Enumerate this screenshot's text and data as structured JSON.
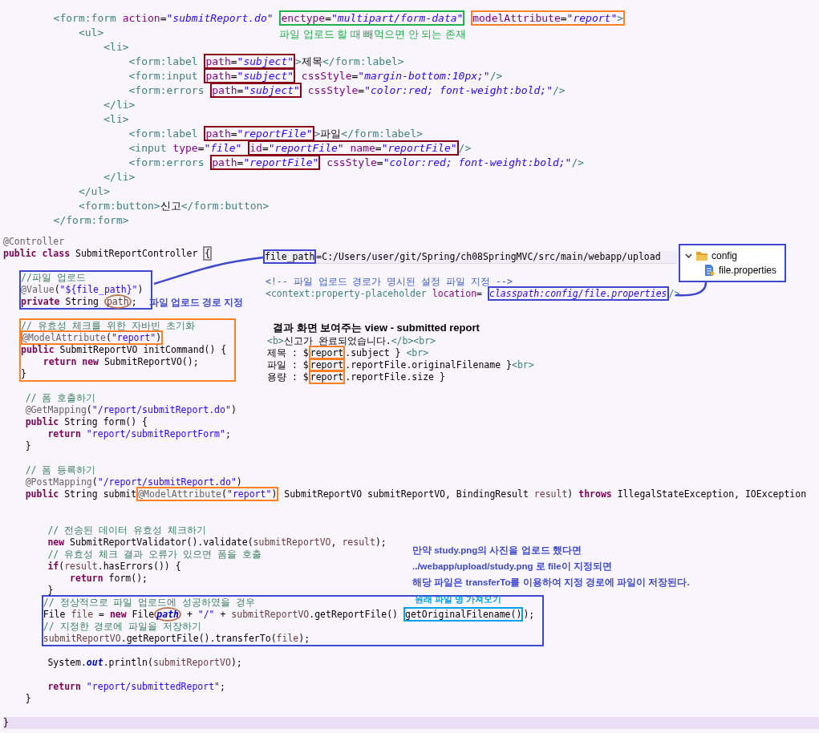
{
  "xml_form": {
    "lines": [
      {
        "kind": "line",
        "parts": [
          {
            "kind": "tag",
            "t": "        <form:form"
          },
          {
            "kind": "attr",
            "t": " action"
          },
          {
            "kind": "plain",
            "t": "="
          },
          {
            "kind": "val",
            "t": "\"submitReport.do\" "
          },
          {
            "kind": "box",
            "color": "#22b14c",
            "note": {
              "kind": "below",
              "text": "파일 업로드 할 때 빼먹으면 안 되는 존재",
              "color": "#22b14c"
            },
            "parts": [
              {
                "kind": "attr",
                "t": "enctype"
              },
              {
                "kind": "plain",
                "t": "="
              },
              {
                "kind": "val",
                "t": "\"multipart/form-data\""
              }
            ]
          },
          {
            "kind": "box",
            "color": "#ff7f27",
            "parts": [
              {
                "kind": "attr",
                "t": "modelAttribute"
              },
              {
                "kind": "plain",
                "t": "="
              },
              {
                "kind": "val",
                "t": "\"report\""
              },
              {
                "kind": "tag",
                "t": ">"
              }
            ]
          }
        ]
      },
      {
        "kind": "line",
        "parts": [
          {
            "kind": "tag",
            "t": "            <ul>"
          }
        ]
      },
      {
        "kind": "line",
        "parts": [
          {
            "kind": "tag",
            "t": "                <li>"
          }
        ]
      },
      {
        "kind": "line",
        "parts": [
          {
            "kind": "tag",
            "t": "                    <form:label "
          },
          {
            "kind": "box",
            "color": "#880015",
            "parts": [
              {
                "kind": "attr",
                "t": "path"
              },
              {
                "kind": "plain",
                "t": "="
              },
              {
                "kind": "val",
                "t": "\"subject\""
              }
            ]
          },
          {
            "kind": "tag",
            "t": ">"
          },
          {
            "kind": "plain",
            "t": "제목"
          },
          {
            "kind": "tag",
            "t": "</form:label>"
          }
        ]
      },
      {
        "kind": "line",
        "parts": [
          {
            "kind": "tag",
            "t": "                    <form:input "
          },
          {
            "kind": "box",
            "color": "#880015",
            "parts": [
              {
                "kind": "attr",
                "t": "path"
              },
              {
                "kind": "plain",
                "t": "="
              },
              {
                "kind": "val",
                "t": "\"subject\""
              }
            ]
          },
          {
            "kind": "attr",
            "t": " cssStyle"
          },
          {
            "kind": "plain",
            "t": "="
          },
          {
            "kind": "val",
            "t": "\"margin-bottom:10px;\""
          },
          {
            "kind": "tag",
            "t": "/>"
          }
        ]
      },
      {
        "kind": "line",
        "parts": [
          {
            "kind": "tag",
            "t": "                    <form:errors "
          },
          {
            "kind": "box",
            "color": "#880015",
            "parts": [
              {
                "kind": "attr",
                "t": "path"
              },
              {
                "kind": "plain",
                "t": "="
              },
              {
                "kind": "val",
                "t": "\"subject\""
              }
            ]
          },
          {
            "kind": "attr",
            "t": " cssStyle"
          },
          {
            "kind": "plain",
            "t": "="
          },
          {
            "kind": "val",
            "t": "\"color:red; font-weight:bold;\""
          },
          {
            "kind": "tag",
            "t": "/>"
          }
        ]
      },
      {
        "kind": "line",
        "parts": [
          {
            "kind": "tag",
            "t": "                </li>"
          }
        ]
      },
      {
        "kind": "line",
        "parts": [
          {
            "kind": "tag",
            "t": "                <li>"
          }
        ]
      },
      {
        "kind": "line",
        "parts": [
          {
            "kind": "tag",
            "t": "                    <form:label "
          },
          {
            "kind": "box",
            "color": "#880015",
            "parts": [
              {
                "kind": "attr",
                "t": "path"
              },
              {
                "kind": "plain",
                "t": "="
              },
              {
                "kind": "val",
                "t": "\"reportFile\""
              }
            ]
          },
          {
            "kind": "tag",
            "t": ">"
          },
          {
            "kind": "plain",
            "t": "파일"
          },
          {
            "kind": "tag",
            "t": "</form:label>"
          }
        ]
      },
      {
        "kind": "line",
        "parts": [
          {
            "kind": "tag",
            "t": "                    <input "
          },
          {
            "kind": "attr",
            "t": "type"
          },
          {
            "kind": "plain",
            "t": "="
          },
          {
            "kind": "val",
            "t": "\"file\" "
          },
          {
            "kind": "box",
            "color": "#880015",
            "parts": [
              {
                "kind": "attr",
                "t": "id"
              },
              {
                "kind": "plain",
                "t": "="
              },
              {
                "kind": "val",
                "t": "\"reportFile\""
              },
              {
                "kind": "attr",
                "t": " name"
              },
              {
                "kind": "plain",
                "t": "="
              },
              {
                "kind": "val",
                "t": "\"reportFile\""
              }
            ]
          },
          {
            "kind": "tag",
            "t": "/>"
          }
        ]
      },
      {
        "kind": "line",
        "parts": [
          {
            "kind": "tag",
            "t": "                    <form:errors "
          },
          {
            "kind": "box",
            "color": "#880015",
            "parts": [
              {
                "kind": "attr",
                "t": "path"
              },
              {
                "kind": "plain",
                "t": "="
              },
              {
                "kind": "val",
                "t": "\"reportFile\""
              }
            ]
          },
          {
            "kind": "attr",
            "t": " cssStyle"
          },
          {
            "kind": "plain",
            "t": "="
          },
          {
            "kind": "val",
            "t": "\"color:red; font-weight:bold;\""
          },
          {
            "kind": "tag",
            "t": "/>"
          }
        ]
      },
      {
        "kind": "line",
        "parts": [
          {
            "kind": "tag",
            "t": "                </li>"
          }
        ]
      },
      {
        "kind": "line",
        "parts": [
          {
            "kind": "tag",
            "t": "            </ul>"
          }
        ]
      },
      {
        "kind": "line",
        "parts": [
          {
            "kind": "tag",
            "t": "            <form:button>"
          },
          {
            "kind": "plain",
            "t": "신고"
          },
          {
            "kind": "tag",
            "t": "</form:button>"
          }
        ]
      },
      {
        "kind": "line",
        "parts": [
          {
            "kind": "tag",
            "t": "        </form:form>"
          }
        ]
      }
    ]
  },
  "controller_code": {
    "lines": [
      {
        "kind": "line",
        "parts": [
          {
            "kind": "ann",
            "t": "@Controller"
          }
        ]
      },
      {
        "kind": "line",
        "parts": [
          {
            "kind": "kw",
            "t": "public class"
          },
          {
            "kind": "plain",
            "t": " SubmitReportController "
          },
          {
            "kind": "box",
            "color": "#8c8c8c",
            "parts": [
              {
                "kind": "plain",
                "t": "{"
              }
            ]
          }
        ]
      },
      {
        "kind": "blank"
      },
      {
        "kind": "member_group",
        "color": "#3f48cc",
        "lines": [
          {
            "kind": "line",
            "parts": [
              {
                "kind": "cm",
                "t": "//파일 업로드"
              }
            ]
          },
          {
            "kind": "line",
            "parts": [
              {
                "kind": "ann",
                "t": "@Value"
              },
              {
                "kind": "plain",
                "t": "("
              },
              {
                "kind": "str",
                "t": "\"${file_path}\""
              },
              {
                "kind": "plain",
                "t": ")"
              }
            ]
          },
          {
            "kind": "line",
            "parts": [
              {
                "kind": "kw",
                "t": "private"
              },
              {
                "kind": "plain",
                "t": " String "
              },
              {
                "kind": "circle",
                "color": "#b97a57",
                "note": {
                  "kind": "right",
                  "text": "파일 업로드 경로 지정",
                  "color": "#3f48cc"
                },
                "parts": [
                  {
                    "kind": "var",
                    "t": "path"
                  }
                ]
              },
              {
                "kind": "plain",
                "t": ";"
              }
            ]
          }
        ]
      },
      {
        "kind": "blank"
      },
      {
        "kind": "member_group",
        "color": "#ff7f27",
        "lines": [
          {
            "kind": "line",
            "parts": [
              {
                "kind": "cm",
                "t": "// 유효성 체크를 위한 자바빈 초기화"
              }
            ]
          },
          {
            "kind": "line",
            "parts": [
              {
                "kind": "box",
                "color": "#ff7f27",
                "parts": [
                  {
                    "kind": "ann",
                    "t": "@ModelAttribute"
                  },
                  {
                    "kind": "plain",
                    "t": "("
                  },
                  {
                    "kind": "str",
                    "t": "\"report\""
                  },
                  {
                    "kind": "plain",
                    "t": ")"
                  }
                ]
              }
            ]
          },
          {
            "kind": "line",
            "parts": [
              {
                "kind": "kw",
                "t": "public"
              },
              {
                "kind": "plain",
                "t": " SubmitReportVO initCommand() {"
              }
            ]
          },
          {
            "kind": "line",
            "parts": [
              {
                "kind": "kw",
                "t": "    return new"
              },
              {
                "kind": "plain",
                "t": " SubmitReportVO();"
              }
            ]
          },
          {
            "kind": "line",
            "parts": [
              {
                "kind": "plain",
                "t": "}"
              }
            ]
          }
        ]
      },
      {
        "kind": "blank"
      },
      {
        "kind": "line",
        "parts": [
          {
            "kind": "cm",
            "t": "    // 폼 호출하기"
          }
        ]
      },
      {
        "kind": "line",
        "parts": [
          {
            "kind": "ann",
            "t": "    @GetMapping"
          },
          {
            "kind": "plain",
            "t": "("
          },
          {
            "kind": "str",
            "t": "\"/report/submitReport.do\""
          },
          {
            "kind": "plain",
            "t": ")"
          }
        ]
      },
      {
        "kind": "line",
        "parts": [
          {
            "kind": "kw",
            "t": "    public"
          },
          {
            "kind": "plain",
            "t": " String form() {"
          }
        ]
      },
      {
        "kind": "line",
        "parts": [
          {
            "kind": "kw",
            "t": "        return"
          },
          {
            "kind": "str",
            "t": " \"report/submitReportForm\""
          },
          {
            "kind": "plain",
            "t": ";"
          }
        ]
      },
      {
        "kind": "line",
        "parts": [
          {
            "kind": "plain",
            "t": "    }"
          }
        ]
      },
      {
        "kind": "blank"
      },
      {
        "kind": "line",
        "parts": [
          {
            "kind": "cm",
            "t": "    // 폼 등록하기"
          }
        ]
      },
      {
        "kind": "line",
        "parts": [
          {
            "kind": "ann",
            "t": "    @PostMapping"
          },
          {
            "kind": "plain",
            "t": "("
          },
          {
            "kind": "str",
            "t": "\"/report/submitReport.do\""
          },
          {
            "kind": "plain",
            "t": ")"
          }
        ]
      },
      {
        "kind": "line",
        "parts": [
          {
            "kind": "kw",
            "t": "    public"
          },
          {
            "kind": "plain",
            "t": " String submit"
          },
          {
            "kind": "box",
            "color": "#ff7f27",
            "parts": [
              {
                "kind": "ann",
                "t": "@ModelAttribute"
              },
              {
                "kind": "plain",
                "t": "("
              },
              {
                "kind": "str",
                "t": "\"report\""
              },
              {
                "kind": "plain",
                "t": ")"
              }
            ]
          },
          {
            "kind": "plain",
            "t": " SubmitReportVO submitReportVO, BindingResult "
          },
          {
            "kind": "var",
            "t": "result"
          },
          {
            "kind": "plain",
            "t": ") "
          },
          {
            "kind": "kw",
            "t": "throws"
          },
          {
            "kind": "plain",
            "t": " IllegalStateException, IOException"
          }
        ]
      },
      {
        "kind": "blank"
      },
      {
        "kind": "blank"
      },
      {
        "kind": "line",
        "parts": [
          {
            "kind": "cm",
            "t": "        // 전송된 데이터 유효성 체크하기"
          }
        ]
      },
      {
        "kind": "line",
        "parts": [
          {
            "kind": "kw",
            "t": "        new"
          },
          {
            "kind": "plain",
            "t": " SubmitReportValidator().validate("
          },
          {
            "kind": "var",
            "t": "submitReportVO"
          },
          {
            "kind": "plain",
            "t": ", "
          },
          {
            "kind": "var",
            "t": "result"
          },
          {
            "kind": "plain",
            "t": ");"
          }
        ]
      },
      {
        "kind": "line",
        "parts": [
          {
            "kind": "cm",
            "t": "        // 유효성 체크 결과 오류가 있으면 폼을 호출"
          }
        ]
      },
      {
        "kind": "line",
        "parts": [
          {
            "kind": "kw",
            "t": "        if"
          },
          {
            "kind": "plain",
            "t": "("
          },
          {
            "kind": "var",
            "t": "result"
          },
          {
            "kind": "plain",
            "t": ".hasErrors()) {"
          }
        ]
      },
      {
        "kind": "line",
        "parts": [
          {
            "kind": "kw",
            "t": "            return"
          },
          {
            "kind": "plain",
            "t": " form();"
          }
        ]
      },
      {
        "kind": "line",
        "parts": [
          {
            "kind": "plain",
            "t": "        }"
          }
        ]
      },
      {
        "kind": "statement_group",
        "color": "#3f48cc",
        "lines": [
          {
            "kind": "line",
            "parts": [
              {
                "kind": "cm",
                "t": "// 정상적으로 파일 업로드에 성공하였을 경우"
              }
            ]
          },
          {
            "kind": "line",
            "parts": [
              {
                "kind": "plain",
                "t": "File "
              },
              {
                "kind": "var",
                "t": "file"
              },
              {
                "kind": "plain",
                "t": " = "
              },
              {
                "kind": "kw",
                "t": "new"
              },
              {
                "kind": "plain",
                "t": " File"
              },
              {
                "kind": "circle",
                "color": "#b97a57",
                "parts": [
                  {
                    "kind": "fld",
                    "t": "path"
                  }
                ]
              },
              {
                "kind": "plain",
                "t": " + "
              },
              {
                "kind": "str",
                "t": "\"/\""
              },
              {
                "kind": "plain",
                "t": " + "
              },
              {
                "kind": "var",
                "t": "submitReportVO"
              },
              {
                "kind": "plain",
                "t": ".getReportFile() "
              },
              {
                "kind": "box",
                "color": "#00a2e8",
                "note": {
                  "kind": "above",
                  "text": "원래 파일 명 가져오기",
                  "color": "#00a2e8"
                },
                "parts": [
                  {
                    "kind": "plain",
                    "t": "getOriginalFilename()"
                  }
                ]
              },
              {
                "kind": "plain",
                "t": ");"
              }
            ]
          },
          {
            "kind": "line",
            "parts": [
              {
                "kind": "cm",
                "t": "// 지정한 경로에 파일을 저장하기"
              }
            ]
          },
          {
            "kind": "line",
            "parts": [
              {
                "kind": "var",
                "t": "submitReportVO"
              },
              {
                "kind": "plain",
                "t": ".getReportFile().transferTo("
              },
              {
                "kind": "var",
                "t": "file"
              },
              {
                "kind": "plain",
                "t": ");"
              }
            ]
          }
        ]
      },
      {
        "kind": "blank"
      },
      {
        "kind": "line",
        "parts": [
          {
            "kind": "plain",
            "t": "        System."
          },
          {
            "kind": "fld",
            "t": "out"
          },
          {
            "kind": "plain",
            "t": ".println("
          },
          {
            "kind": "var",
            "t": "submitReportVO"
          },
          {
            "kind": "plain",
            "t": ");"
          }
        ]
      },
      {
        "kind": "blank"
      },
      {
        "kind": "line",
        "parts": [
          {
            "kind": "kw",
            "t": "        return"
          },
          {
            "kind": "str",
            "t": " \"report/submittedReport\""
          },
          {
            "kind": "plain",
            "t": ";"
          }
        ]
      },
      {
        "kind": "line",
        "parts": [
          {
            "kind": "plain",
            "t": "    }"
          }
        ]
      },
      {
        "kind": "blank"
      },
      {
        "kind": "current",
        "parts": [
          {
            "kind": "plain",
            "t": "}"
          }
        ]
      }
    ]
  },
  "properties_line": {
    "parts": [
      {
        "kind": "box",
        "color": "#3f48cc",
        "parts": [
          {
            "kind": "plain",
            "t": "file_path"
          }
        ]
      },
      {
        "kind": "plain",
        "t": "=C:/Users/user/git/Spring/ch08SpringMVC/src/main/webapp/upload"
      }
    ]
  },
  "project_tree": [
    {
      "label": "config",
      "kind": "folder",
      "expanded": true,
      "children": [
        {
          "label": "file.properties",
          "kind": "file"
        }
      ]
    }
  ],
  "config_xml": {
    "lines": [
      {
        "kind": "line",
        "parts": [
          {
            "kind": "xc",
            "t": "<!-- 파일 업로드 경로가 명시된 설정 파일 지정 -->"
          }
        ]
      },
      {
        "kind": "line",
        "parts": [
          {
            "kind": "tag",
            "t": "<context:property-placeholder"
          },
          {
            "kind": "attr",
            "t": " location"
          },
          {
            "kind": "plain",
            "t": "= "
          },
          {
            "kind": "box",
            "color": "#3f48cc",
            "parts": [
              {
                "kind": "val",
                "t": "classpath:config/file.properties"
              }
            ]
          },
          {
            "kind": "tag",
            "t": "/>"
          }
        ]
      }
    ]
  },
  "view_snippet": {
    "title": "결과 화면 보여주는 view - submitted report",
    "lines": [
      {
        "kind": "line",
        "parts": [
          {
            "kind": "tag",
            "t": "<b>"
          },
          {
            "kind": "plain",
            "t": "신고가 완료되었습니다."
          },
          {
            "kind": "tag",
            "t": "</b><br>"
          }
        ]
      },
      {
        "kind": "line",
        "parts": [
          {
            "kind": "plain",
            "t": "제목 : $"
          },
          {
            "kind": "box",
            "color": "#ff7f27",
            "parts": [
              {
                "kind": "plain",
                "t": "report"
              }
            ]
          },
          {
            "kind": "plain",
            "t": ".subject } "
          },
          {
            "kind": "tag",
            "t": "<br>"
          }
        ]
      },
      {
        "kind": "line",
        "parts": [
          {
            "kind": "plain",
            "t": "파일 : $"
          },
          {
            "kind": "box",
            "color": "#ff7f27",
            "parts": [
              {
                "kind": "plain",
                "t": "report"
              }
            ]
          },
          {
            "kind": "plain",
            "t": ".reportFile.originalFilename }"
          },
          {
            "kind": "tag",
            "t": "<br>"
          }
        ]
      },
      {
        "kind": "line",
        "parts": [
          {
            "kind": "plain",
            "t": "용량 : $"
          },
          {
            "kind": "box",
            "color": "#ff7f27",
            "parts": [
              {
                "kind": "plain",
                "t": "report"
              }
            ]
          },
          {
            "kind": "plain",
            "t": ".reportFile.size }"
          }
        ]
      }
    ]
  },
  "upload_note": {
    "lines": [
      "만약 study.png의 사진을 업로드 했다면",
      "../webapp/upload/study.png 로 file이 지정되면",
      "해당 파일은 transferTo를 이용하여 지정 경로에 파일이 저장된다."
    ]
  }
}
